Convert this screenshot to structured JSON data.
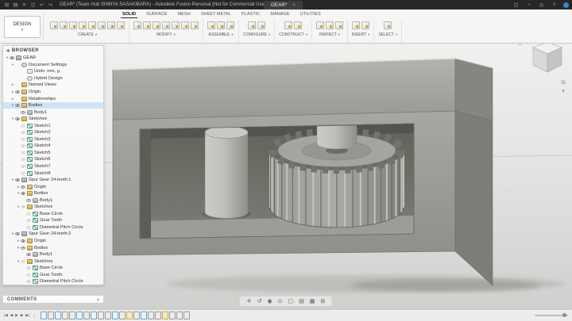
{
  "titlebar": {
    "app_title": "GEAR* (Team Hub SHINYA SASAKIBARA) - Autodesk Fusion Personal (Not for Commercial Use)",
    "tab_label": "GEAR*",
    "tab_close": "×",
    "left_icons": [
      {
        "name": "apps-grid-icon",
        "glyph": "⊞"
      },
      {
        "name": "data-panel-icon",
        "glyph": "▤"
      },
      {
        "name": "file-menu-icon",
        "glyph": "≡"
      },
      {
        "name": "save-icon",
        "glyph": "◫"
      },
      {
        "name": "undo-icon",
        "glyph": "↩"
      },
      {
        "name": "redo-icon",
        "glyph": "↪"
      }
    ],
    "right_icons": [
      {
        "name": "extensions-icon",
        "glyph": "◫"
      },
      {
        "name": "job-status-icon",
        "glyph": "◔"
      },
      {
        "name": "notifications-icon",
        "glyph": "◷"
      },
      {
        "name": "help-icon",
        "glyph": "?"
      },
      {
        "name": "avatar",
        "glyph": ""
      }
    ]
  },
  "ribbon": {
    "workspace": {
      "label": "DESIGN",
      "caret": "▾"
    },
    "tabs": [
      {
        "label": "SOLID",
        "active": true
      },
      {
        "label": "SURFACE",
        "active": false
      },
      {
        "label": "MESH",
        "active": false
      },
      {
        "label": "SHEET METAL",
        "active": false
      },
      {
        "label": "PLASTIC",
        "active": false
      },
      {
        "label": "MANAGE",
        "active": false
      },
      {
        "label": "UTILITIES",
        "active": false
      }
    ],
    "groups": [
      {
        "label": "CREATE",
        "caret": "▾",
        "icon_count": 8
      },
      {
        "label": "MODIFY",
        "caret": "▾",
        "icon_count": 7
      },
      {
        "label": "ASSEMBLE",
        "caret": "▾",
        "icon_count": 3
      },
      {
        "label": "CONFIGURE",
        "caret": "▾",
        "icon_count": 2
      },
      {
        "label": "CONSTRUCT",
        "caret": "▾",
        "icon_count": 2
      },
      {
        "label": "INSPECT",
        "caret": "▾",
        "icon_count": 3
      },
      {
        "label": "INSERT",
        "caret": "▾",
        "icon_count": 2
      },
      {
        "label": "SELECT",
        "caret": "▾",
        "icon_count": 1
      }
    ]
  },
  "browser": {
    "header": "BROWSER",
    "tree": [
      {
        "label": "GEAR",
        "level": 0,
        "icon": "component",
        "caret": "open",
        "eye": true,
        "selected": false
      },
      {
        "label": "Document Settings",
        "level": 1,
        "icon": "settings",
        "caret": "open",
        "eye": null,
        "selected": false
      },
      {
        "label": "Units: mm, g",
        "level": 2,
        "icon": "units",
        "caret": null,
        "eye": null,
        "selected": false
      },
      {
        "label": "Hybrid Design",
        "level": 2,
        "icon": "info",
        "caret": null,
        "eye": null,
        "selected": false
      },
      {
        "label": "Named Views",
        "level": 1,
        "icon": "folder",
        "caret": "closed",
        "eye": null,
        "selected": false
      },
      {
        "label": "Origin",
        "level": 1,
        "icon": "folder",
        "caret": "closed",
        "eye": true,
        "selected": false
      },
      {
        "label": "Relationships",
        "level": 1,
        "icon": "folder",
        "caret": "closed",
        "eye": null,
        "selected": false
      },
      {
        "label": "Bodies",
        "level": 1,
        "icon": "folder",
        "caret": "open",
        "eye": true,
        "selected": true
      },
      {
        "label": "Body1",
        "level": 2,
        "icon": "body",
        "caret": null,
        "eye": true,
        "selected": false
      },
      {
        "label": "Sketches",
        "level": 1,
        "icon": "folder",
        "caret": "open",
        "eye": true,
        "selected": false
      },
      {
        "label": "Sketch1",
        "level": 2,
        "icon": "sketch",
        "caret": null,
        "eye": false,
        "selected": false
      },
      {
        "label": "Sketch2",
        "level": 2,
        "icon": "sketch",
        "caret": null,
        "eye": false,
        "selected": false
      },
      {
        "label": "Sketch3",
        "level": 2,
        "icon": "sketch",
        "caret": null,
        "eye": false,
        "selected": false
      },
      {
        "label": "Sketch4",
        "level": 2,
        "icon": "sketch",
        "caret": null,
        "eye": false,
        "selected": false
      },
      {
        "label": "Sketch5",
        "level": 2,
        "icon": "sketch",
        "caret": null,
        "eye": false,
        "selected": false
      },
      {
        "label": "Sketch6",
        "level": 2,
        "icon": "sketch",
        "caret": null,
        "eye": false,
        "selected": false
      },
      {
        "label": "Sketch7",
        "level": 2,
        "icon": "sketch",
        "caret": null,
        "eye": false,
        "selected": false
      },
      {
        "label": "Sketch8",
        "level": 2,
        "icon": "sketch",
        "caret": null,
        "eye": false,
        "selected": false
      },
      {
        "label": "Spur Gear 24-teeth:1",
        "level": 1,
        "icon": "component",
        "caret": "open",
        "eye": true,
        "selected": false
      },
      {
        "label": "Origin",
        "level": 2,
        "icon": "folder",
        "caret": "closed",
        "eye": true,
        "selected": false
      },
      {
        "label": "Bodies",
        "level": 2,
        "icon": "folder",
        "caret": "open",
        "eye": true,
        "selected": false
      },
      {
        "label": "Body1",
        "level": 3,
        "icon": "body",
        "caret": null,
        "eye": true,
        "selected": false
      },
      {
        "label": "Sketches",
        "level": 2,
        "icon": "folder",
        "caret": "open",
        "eye": false,
        "selected": false
      },
      {
        "label": "Base Circle",
        "level": 3,
        "icon": "sketch",
        "caret": null,
        "eye": false,
        "selected": false
      },
      {
        "label": "Gear Tooth",
        "level": 3,
        "icon": "sketch",
        "caret": null,
        "eye": false,
        "selected": false
      },
      {
        "label": "Diametral Pitch Circle",
        "level": 3,
        "icon": "sketch",
        "caret": null,
        "eye": false,
        "selected": false
      },
      {
        "label": "Spur Gear 24-teeth:2",
        "level": 1,
        "icon": "component",
        "caret": "open",
        "eye": true,
        "selected": false
      },
      {
        "label": "Origin",
        "level": 2,
        "icon": "folder",
        "caret": "closed",
        "eye": true,
        "selected": false
      },
      {
        "label": "Bodies",
        "level": 2,
        "icon": "folder",
        "caret": "open",
        "eye": true,
        "selected": false
      },
      {
        "label": "Body1",
        "level": 3,
        "icon": "body",
        "caret": null,
        "eye": true,
        "selected": false
      },
      {
        "label": "Sketches",
        "level": 2,
        "icon": "folder",
        "caret": "open",
        "eye": false,
        "selected": false
      },
      {
        "label": "Base Circle",
        "level": 3,
        "icon": "sketch",
        "caret": null,
        "eye": false,
        "selected": false
      },
      {
        "label": "Gear Tooth",
        "level": 3,
        "icon": "sketch",
        "caret": null,
        "eye": false,
        "selected": false
      },
      {
        "label": "Diametral Pitch Circle",
        "level": 3,
        "icon": "sketch",
        "caret": null,
        "eye": false,
        "selected": false
      }
    ]
  },
  "comments": {
    "label": "COMMENTS",
    "caret": "▴"
  },
  "navbar": {
    "items": [
      {
        "name": "pan-icon",
        "glyph": "✛"
      },
      {
        "name": "orbit-icon",
        "glyph": "↺"
      },
      {
        "name": "look-at-icon",
        "glyph": "◉"
      },
      {
        "name": "zoom-icon",
        "glyph": "⊙"
      },
      {
        "name": "fit-icon",
        "glyph": "▢"
      },
      {
        "name": "display-settings-icon",
        "glyph": "▤"
      },
      {
        "name": "grid-settings-icon",
        "glyph": "▦"
      },
      {
        "name": "viewports-icon",
        "glyph": "⊞"
      }
    ]
  },
  "viewcube": {
    "home_glyph": "⌂",
    "extra_icons": [
      {
        "name": "fullscreen-icon",
        "glyph": "⊞"
      },
      {
        "name": "cube-menu-icon",
        "glyph": "▾"
      }
    ]
  },
  "timeline": {
    "controls": [
      {
        "name": "go-to-start-icon",
        "glyph": "|◀"
      },
      {
        "name": "step-back-icon",
        "glyph": "◀"
      },
      {
        "name": "play-icon",
        "glyph": "▶"
      },
      {
        "name": "step-forward-icon",
        "glyph": "▶"
      },
      {
        "name": "go-to-end-icon",
        "glyph": "▶|"
      }
    ],
    "icons": [
      "sketch",
      "feature",
      "sketch",
      "feature",
      "feature",
      "sketch",
      "feature",
      "sketch",
      "feature",
      "feature",
      "sketch",
      "feature",
      "component",
      "feature",
      "sketch",
      "feature",
      "feature",
      "component",
      "feature",
      "feature",
      "feature"
    ]
  },
  "colors": {
    "selection_blue": "#cfe4f7",
    "titlebar_bg": "#262626",
    "ribbon_bg": "#f5f5f4",
    "model_gray": "#9b9c95",
    "accent_amber": "#d79b2e"
  }
}
